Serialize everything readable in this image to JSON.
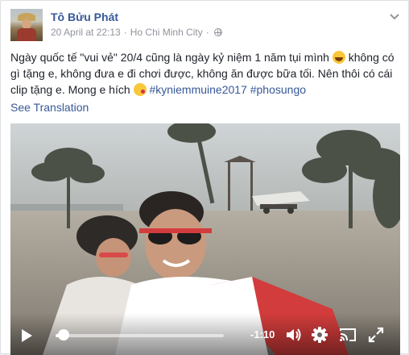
{
  "post": {
    "author_name": "Tô Bửu Phát",
    "date": "20 April at 22:13",
    "separator": "·",
    "location": "Ho Chi Minh City",
    "separator2": "·",
    "privacy_icon": "globe-icon",
    "options_icon": "chevron-down-icon",
    "text_part1": "Ngày quốc tế \"vui vẻ\" 20/4 cũng là ngày kỷ niệm 1 năm tụi mình ",
    "emoji1": "laughing-emoji",
    "text_part2": " không có gì tặng e, không đưa e đi chơi được, không ăn được bữa tối. Nên thôi có cái clip tặng e. Mong e hích ",
    "emoji2": "kissing-emoji",
    "hashtag1": "#kyniemmuine2017",
    "hashtag2": "#phosungo",
    "see_translation": "See Translation"
  },
  "video": {
    "time_remaining": "-1:10",
    "progress": 0.05,
    "icons": [
      "play-icon",
      "volume-icon",
      "settings-icon",
      "cast-icon",
      "fullscreen-icon"
    ]
  }
}
